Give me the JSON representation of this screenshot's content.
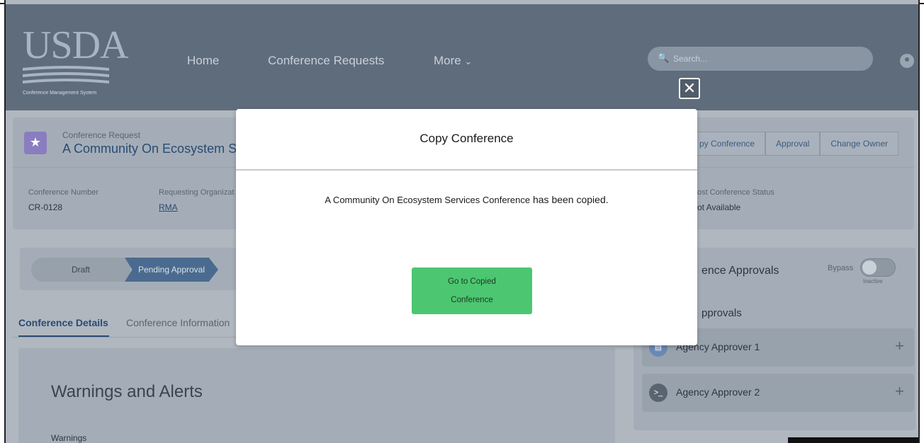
{
  "header": {
    "logo_text": "USDA",
    "logo_subtitle": "Conference Management System",
    "nav": [
      "Home",
      "Conference Requests",
      "More"
    ],
    "search_placeholder": "Search..."
  },
  "record": {
    "object_label": "Conference Request",
    "title": "A Community On Ecosystem Serv",
    "actions": [
      "py Conference",
      "Approval",
      "Change Owner"
    ],
    "fields": {
      "number_label": "Conference Number",
      "number_value": "CR-0128",
      "org_label": "Requesting Organizat",
      "org_value": "RMA",
      "post_label": "ost Conference Status",
      "post_value": "ot Available"
    }
  },
  "path": {
    "steps": [
      "Draft",
      "Pending Approval"
    ]
  },
  "tabs": [
    "Conference Details",
    "Conference Information"
  ],
  "details": {
    "heading": "Warnings and Alerts",
    "subheading": "Warnings"
  },
  "approvals": {
    "title": "ence Approvals",
    "bypass_label": "Bypass",
    "bypass_state": "Inactive",
    "list_label": "pprovals",
    "approvers": [
      "Agency Approver 1",
      "Agency Approver 2"
    ]
  },
  "modal": {
    "title": "Copy Conference",
    "message_name": "A Community On Ecosystem Services Conference",
    "message_suffix": " has been copied.",
    "button_line1": "Go to Copied",
    "button_line2": "Conference",
    "close_label": "✕"
  },
  "colors": {
    "header_bg": "#5f6c7b",
    "overlay_bg": "#b0b7bf",
    "button_green": "#4cc671",
    "link_blue": "#2a4b74"
  }
}
